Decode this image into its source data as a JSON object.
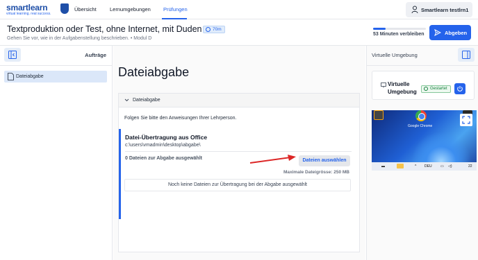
{
  "brand": {
    "name": "smartlearn",
    "tagline": "virtual learning. real success."
  },
  "nav": {
    "items": [
      {
        "label": "Übersicht"
      },
      {
        "label": "Lernumgebungen"
      },
      {
        "label": "Prüfungen",
        "active": true
      }
    ]
  },
  "user": {
    "label": "Smartlearn testlrn1"
  },
  "header": {
    "title": "Textproduktion oder Test, ohne Internet, mit Duden",
    "time_badge": "70m",
    "subtitle": "Gehen Sie vor, wie in der Aufgabenstellung beschrieben. • Modul D",
    "remaining": "53 Minuten verbleiben",
    "progress_fraction": 0.24,
    "submit_label": "Abgeben"
  },
  "left_panel": {
    "title": "Aufträge",
    "items": [
      {
        "label": "Dateiabgabe"
      }
    ]
  },
  "main": {
    "title": "Dateiabgabe",
    "card_header": "Dateiabgabe",
    "instruction": "Folgen Sie bitte den Anweisungen Ihrer Lehrperson.",
    "upload": {
      "title": "Datei-Übertragung aus Office",
      "path": "c:\\users\\vmadmin\\desktop\\abgabe\\",
      "count": "0 Dateien zur Abgabe ausgewählt",
      "choose_label": "Dateien auswählen",
      "max_size": "Maximale Dateigrösse: 250 MB",
      "empty_message": "Noch keine Dateien zur Übertragung bei der Abgabe ausgewählt"
    }
  },
  "right_panel": {
    "title": "Virtuelle Umgebung",
    "vm_title": "Virtuelle Umgebung",
    "status": "Gestartet",
    "desktop": {
      "icons": [
        "Google Chrome"
      ],
      "taskbar_lang": "DEU",
      "taskbar_time": "22"
    }
  },
  "colors": {
    "accent": "#2563eb",
    "success": "#15803d",
    "annotation_arrow": "#dc2626"
  }
}
